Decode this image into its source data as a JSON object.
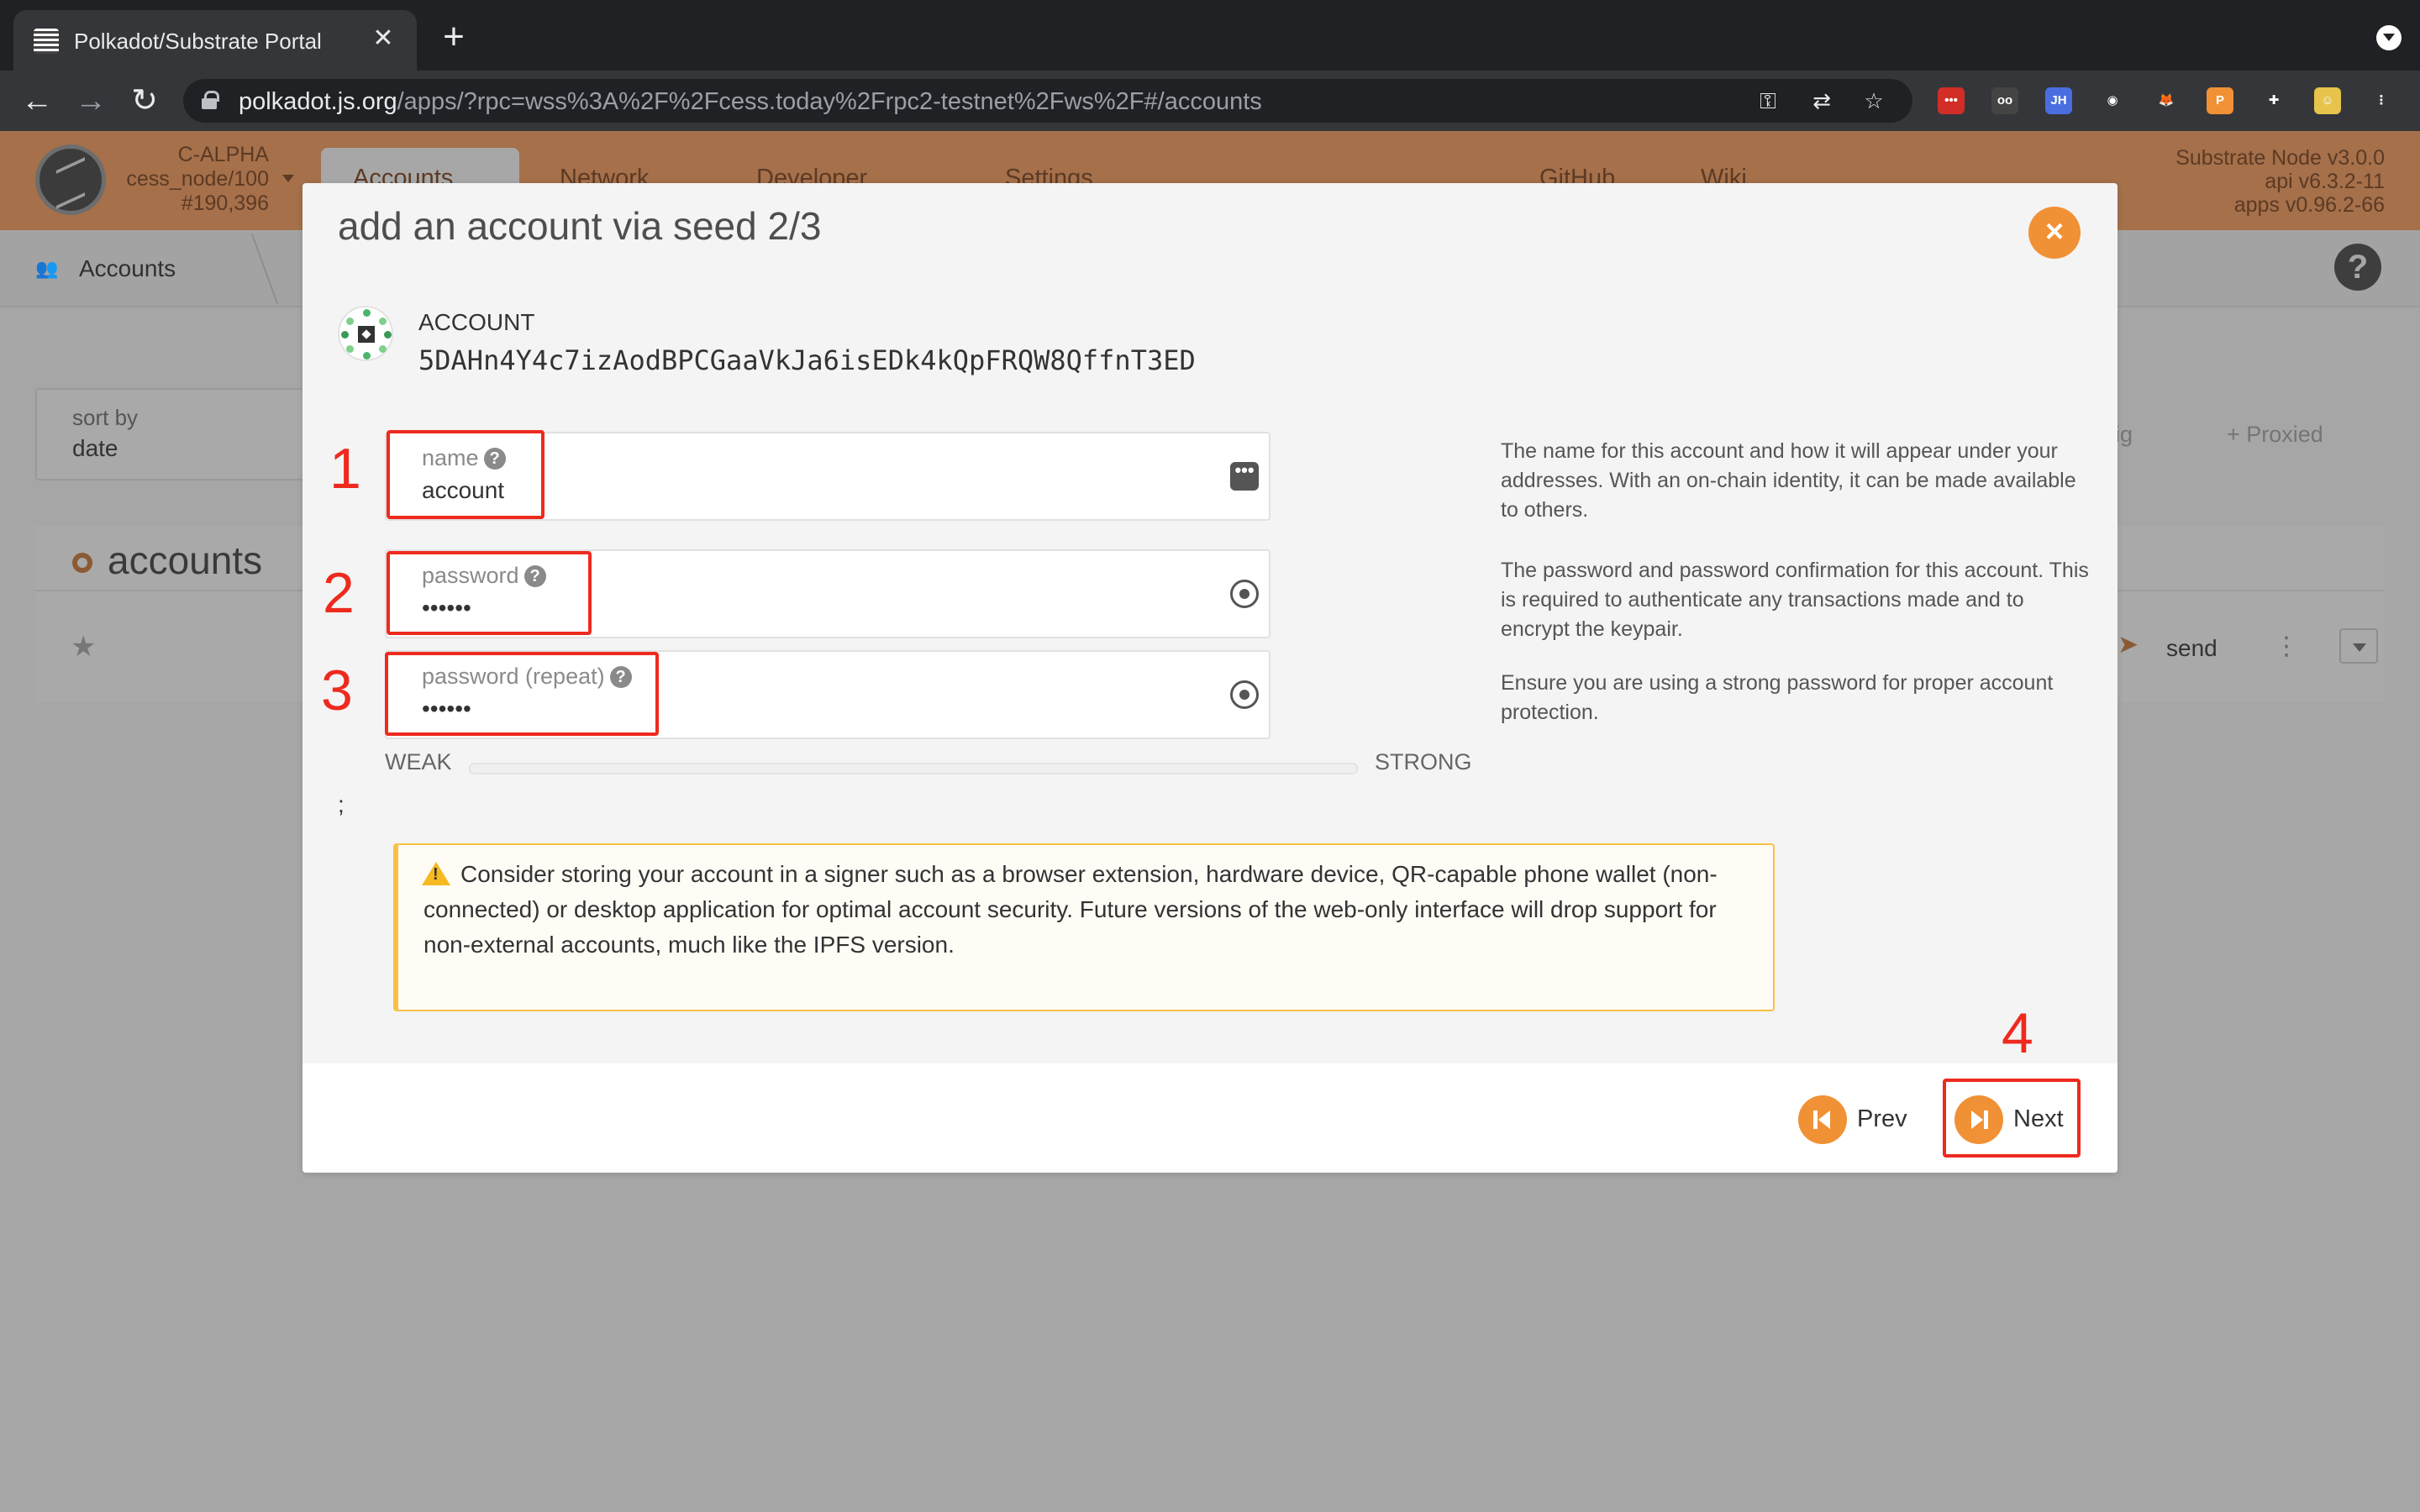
{
  "browser": {
    "tab_title": "Polkadot/Substrate Portal",
    "tab_close": "✕",
    "new_tab": "+",
    "url_host": "polkadot.js.org",
    "url_path": "/apps/?rpc=wss%3A%2F%2Fcess.today%2Frpc2-testnet%2Fws%2F#/accounts",
    "back": "←",
    "forward": "→",
    "reload": "↻",
    "extensions": [
      {
        "icon": "lastpass-icon",
        "glyph": "•••",
        "color": "#d32d27"
      },
      {
        "icon": "glasses-icon",
        "glyph": "oo",
        "color": "#444444"
      },
      {
        "icon": "jh-icon",
        "glyph": "JH",
        "color": "#4a6ee0"
      },
      {
        "icon": "color-wheel-icon",
        "glyph": "◉",
        "color": "#35363a"
      },
      {
        "icon": "metamask-icon",
        "glyph": "🦊",
        "color": "#35363a"
      },
      {
        "icon": "polkadot-ext-icon",
        "glyph": "P",
        "color": "#f19135"
      },
      {
        "icon": "puzzle-icon",
        "glyph": "✚",
        "color": "#35363a"
      },
      {
        "icon": "profile-avatar-icon",
        "glyph": "☺",
        "color": "#e6c34a"
      },
      {
        "icon": "kebab-menu-icon",
        "glyph": "⋮",
        "color": "#35363a"
      }
    ]
  },
  "app": {
    "chain_name": "C-ALPHA",
    "node_name": "cess_node/100",
    "block": "#190,396",
    "menu": {
      "accounts": "Accounts",
      "network": "Network",
      "developer": "Developer",
      "settings": "Settings",
      "github": "GitHub",
      "wiki": "Wiki"
    },
    "node_info": [
      "Substrate Node v3.0.0",
      "api v6.3.2-11",
      "apps v0.96.2-66"
    ],
    "subnav_label": "Accounts",
    "help": "?",
    "sort_label": "sort by",
    "sort_value": "date",
    "multisig_label": "tisig",
    "proxied_label": "+  Proxied",
    "accounts_title": "accounts",
    "send_label": "send"
  },
  "modal": {
    "title": "add an account via seed 2/3",
    "close": "×",
    "account_label": "ACCOUNT",
    "account_address": "5DAHn4Y4c7izAodBPCGaaVkJa6isEDk4kQpFRQW8QffnT3ED",
    "name_label": "name",
    "name_value": "account",
    "password_label": "password",
    "password_value": "••••••",
    "password_repeat_label": "password (repeat)",
    "password_repeat_value": "••••••",
    "help_name": "The name for this account and how it will appear under your addresses. With an on-chain identity, it can be made available to others.",
    "help_password": "The password and password confirmation for this account. This is required to authenticate any transactions made and to encrypt the keypair.",
    "help_strong": "Ensure you are using a strong password for proper account protection.",
    "weak": "WEAK",
    "strong": "STRONG",
    "password_strength": 0,
    "stray_text": ";",
    "warning": "Consider storing your account in a signer such as a browser extension, hardware device, QR-capable phone wallet (non-connected) or desktop application for optimal account security. Future versions of the web-only interface will drop support for non-external accounts, much like the IPFS version.",
    "prev": "Prev",
    "next": "Next"
  },
  "annotations": [
    "1",
    "2",
    "3",
    "4"
  ],
  "colors": {
    "accent": "#f19135",
    "annotation": "#ee2a1e",
    "warning_border": "#f8c145"
  }
}
